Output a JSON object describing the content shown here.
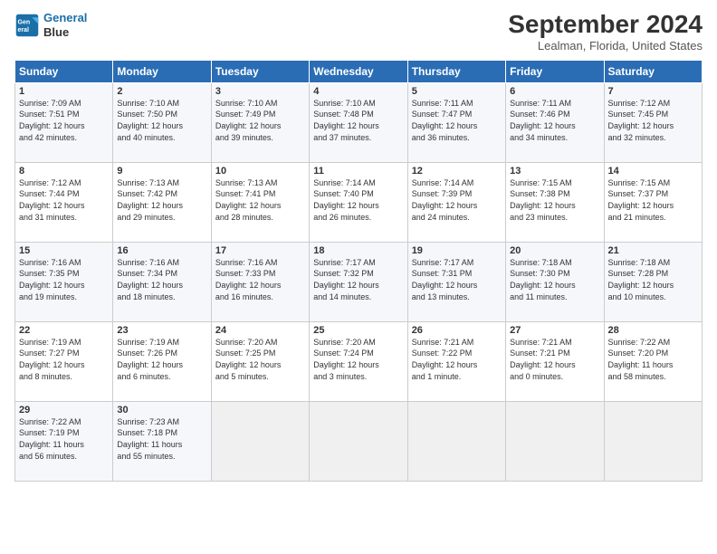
{
  "header": {
    "logo_line1": "General",
    "logo_line2": "Blue",
    "month": "September 2024",
    "location": "Lealman, Florida, United States"
  },
  "days_of_week": [
    "Sunday",
    "Monday",
    "Tuesday",
    "Wednesday",
    "Thursday",
    "Friday",
    "Saturday"
  ],
  "weeks": [
    [
      {
        "day": "1",
        "sunrise": "7:09 AM",
        "sunset": "7:51 PM",
        "daylight": "12 hours and 42 minutes."
      },
      {
        "day": "2",
        "sunrise": "7:10 AM",
        "sunset": "7:50 PM",
        "daylight": "12 hours and 40 minutes."
      },
      {
        "day": "3",
        "sunrise": "7:10 AM",
        "sunset": "7:49 PM",
        "daylight": "12 hours and 39 minutes."
      },
      {
        "day": "4",
        "sunrise": "7:10 AM",
        "sunset": "7:48 PM",
        "daylight": "12 hours and 37 minutes."
      },
      {
        "day": "5",
        "sunrise": "7:11 AM",
        "sunset": "7:47 PM",
        "daylight": "12 hours and 36 minutes."
      },
      {
        "day": "6",
        "sunrise": "7:11 AM",
        "sunset": "7:46 PM",
        "daylight": "12 hours and 34 minutes."
      },
      {
        "day": "7",
        "sunrise": "7:12 AM",
        "sunset": "7:45 PM",
        "daylight": "12 hours and 32 minutes."
      }
    ],
    [
      {
        "day": "8",
        "sunrise": "7:12 AM",
        "sunset": "7:44 PM",
        "daylight": "12 hours and 31 minutes."
      },
      {
        "day": "9",
        "sunrise": "7:13 AM",
        "sunset": "7:42 PM",
        "daylight": "12 hours and 29 minutes."
      },
      {
        "day": "10",
        "sunrise": "7:13 AM",
        "sunset": "7:41 PM",
        "daylight": "12 hours and 28 minutes."
      },
      {
        "day": "11",
        "sunrise": "7:14 AM",
        "sunset": "7:40 PM",
        "daylight": "12 hours and 26 minutes."
      },
      {
        "day": "12",
        "sunrise": "7:14 AM",
        "sunset": "7:39 PM",
        "daylight": "12 hours and 24 minutes."
      },
      {
        "day": "13",
        "sunrise": "7:15 AM",
        "sunset": "7:38 PM",
        "daylight": "12 hours and 23 minutes."
      },
      {
        "day": "14",
        "sunrise": "7:15 AM",
        "sunset": "7:37 PM",
        "daylight": "12 hours and 21 minutes."
      }
    ],
    [
      {
        "day": "15",
        "sunrise": "7:16 AM",
        "sunset": "7:35 PM",
        "daylight": "12 hours and 19 minutes."
      },
      {
        "day": "16",
        "sunrise": "7:16 AM",
        "sunset": "7:34 PM",
        "daylight": "12 hours and 18 minutes."
      },
      {
        "day": "17",
        "sunrise": "7:16 AM",
        "sunset": "7:33 PM",
        "daylight": "12 hours and 16 minutes."
      },
      {
        "day": "18",
        "sunrise": "7:17 AM",
        "sunset": "7:32 PM",
        "daylight": "12 hours and 14 minutes."
      },
      {
        "day": "19",
        "sunrise": "7:17 AM",
        "sunset": "7:31 PM",
        "daylight": "12 hours and 13 minutes."
      },
      {
        "day": "20",
        "sunrise": "7:18 AM",
        "sunset": "7:30 PM",
        "daylight": "12 hours and 11 minutes."
      },
      {
        "day": "21",
        "sunrise": "7:18 AM",
        "sunset": "7:28 PM",
        "daylight": "12 hours and 10 minutes."
      }
    ],
    [
      {
        "day": "22",
        "sunrise": "7:19 AM",
        "sunset": "7:27 PM",
        "daylight": "12 hours and 8 minutes."
      },
      {
        "day": "23",
        "sunrise": "7:19 AM",
        "sunset": "7:26 PM",
        "daylight": "12 hours and 6 minutes."
      },
      {
        "day": "24",
        "sunrise": "7:20 AM",
        "sunset": "7:25 PM",
        "daylight": "12 hours and 5 minutes."
      },
      {
        "day": "25",
        "sunrise": "7:20 AM",
        "sunset": "7:24 PM",
        "daylight": "12 hours and 3 minutes."
      },
      {
        "day": "26",
        "sunrise": "7:21 AM",
        "sunset": "7:22 PM",
        "daylight": "12 hours and 1 minute."
      },
      {
        "day": "27",
        "sunrise": "7:21 AM",
        "sunset": "7:21 PM",
        "daylight": "12 hours and 0 minutes."
      },
      {
        "day": "28",
        "sunrise": "7:22 AM",
        "sunset": "7:20 PM",
        "daylight": "11 hours and 58 minutes."
      }
    ],
    [
      {
        "day": "29",
        "sunrise": "7:22 AM",
        "sunset": "7:19 PM",
        "daylight": "11 hours and 56 minutes."
      },
      {
        "day": "30",
        "sunrise": "7:23 AM",
        "sunset": "7:18 PM",
        "daylight": "11 hours and 55 minutes."
      },
      null,
      null,
      null,
      null,
      null
    ]
  ]
}
